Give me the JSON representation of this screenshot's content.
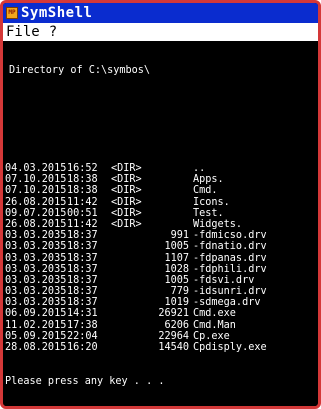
{
  "window": {
    "title": "SymShell",
    "icon": "app-icon"
  },
  "menu": {
    "items": [
      {
        "label": "File"
      },
      {
        "label": "?"
      }
    ]
  },
  "console": {
    "header": "Directory of C:\\symbos\\",
    "entries": [
      {
        "date": "04.03.2015",
        "time": "16:52",
        "dir": "<DIR>",
        "size": "",
        "name": ".."
      },
      {
        "date": "07.10.2015",
        "time": "18:38",
        "dir": "<DIR>",
        "size": "",
        "name": "Apps."
      },
      {
        "date": "07.10.2015",
        "time": "18:38",
        "dir": "<DIR>",
        "size": "",
        "name": "Cmd."
      },
      {
        "date": "26.08.2015",
        "time": "11:42",
        "dir": "<DIR>",
        "size": "",
        "name": "Icons."
      },
      {
        "date": "09.07.2015",
        "time": "00:51",
        "dir": "<DIR>",
        "size": "",
        "name": "Test."
      },
      {
        "date": "26.08.2015",
        "time": "11:42",
        "dir": "<DIR>",
        "size": "",
        "name": "Widgets."
      },
      {
        "date": "03.03.2035",
        "time": "18:37",
        "dir": "",
        "size": "991",
        "name": "-fdmicso.drv"
      },
      {
        "date": "03.03.2035",
        "time": "18:37",
        "dir": "",
        "size": "1005",
        "name": "-fdnatio.drv"
      },
      {
        "date": "03.03.2035",
        "time": "18:37",
        "dir": "",
        "size": "1107",
        "name": "-fdpanas.drv"
      },
      {
        "date": "03.03.2035",
        "time": "18:37",
        "dir": "",
        "size": "1028",
        "name": "-fdphili.drv"
      },
      {
        "date": "03.03.2035",
        "time": "18:37",
        "dir": "",
        "size": "1005",
        "name": "-fdsvi.drv"
      },
      {
        "date": "03.03.2035",
        "time": "18:37",
        "dir": "",
        "size": "779",
        "name": "-idsunri.drv"
      },
      {
        "date": "03.03.2035",
        "time": "18:37",
        "dir": "",
        "size": "1019",
        "name": "-sdmega.drv"
      },
      {
        "date": "06.09.2015",
        "time": "14:31",
        "dir": "",
        "size": "26921",
        "name": "Cmd.exe"
      },
      {
        "date": "11.02.2015",
        "time": "17:38",
        "dir": "",
        "size": "6206",
        "name": "Cmd.Man"
      },
      {
        "date": "05.09.2015",
        "time": "22:04",
        "dir": "",
        "size": "22964",
        "name": "Cp.exe"
      },
      {
        "date": "28.08.2015",
        "time": "16:20",
        "dir": "",
        "size": "14540",
        "name": "Cpdisply.exe"
      }
    ],
    "prompt": "Please press any key . . ."
  }
}
